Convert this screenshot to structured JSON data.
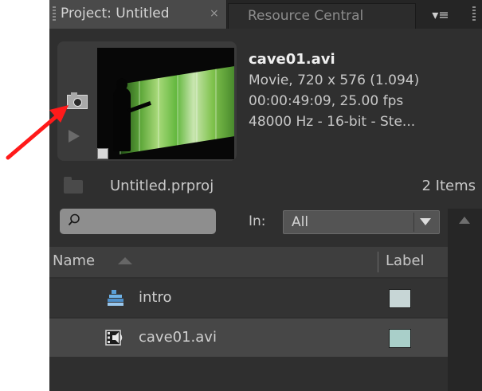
{
  "tabs": {
    "active_label": "Project: Untitled",
    "close_glyph": "×",
    "inactive_label": "Resource Central",
    "menu_glyph": "▾≡"
  },
  "preview": {
    "clip_name": "cave01.avi",
    "details": [
      "Movie, 720 x 576 (1.094)",
      "00:00:49:09, 25.00 fps",
      "48000 Hz - 16-bit - Ste..."
    ],
    "icons": [
      "camera-icon",
      "play-icon"
    ]
  },
  "bin": {
    "project_file": "Untitled.prproj",
    "item_count": "2 Items"
  },
  "search": {
    "placeholder": "",
    "in_label": "In:",
    "in_selected": "All"
  },
  "list": {
    "columns": {
      "name": "Name",
      "label": "Label"
    },
    "rows": [
      {
        "name": "intro",
        "icon": "sequence-icon",
        "label_color": "#c7d6d6"
      },
      {
        "name": "cave01.avi",
        "icon": "movie-icon",
        "label_color": "#a9cfc9"
      }
    ]
  },
  "annotation": {
    "arrow_color": "#ff1a1a"
  }
}
